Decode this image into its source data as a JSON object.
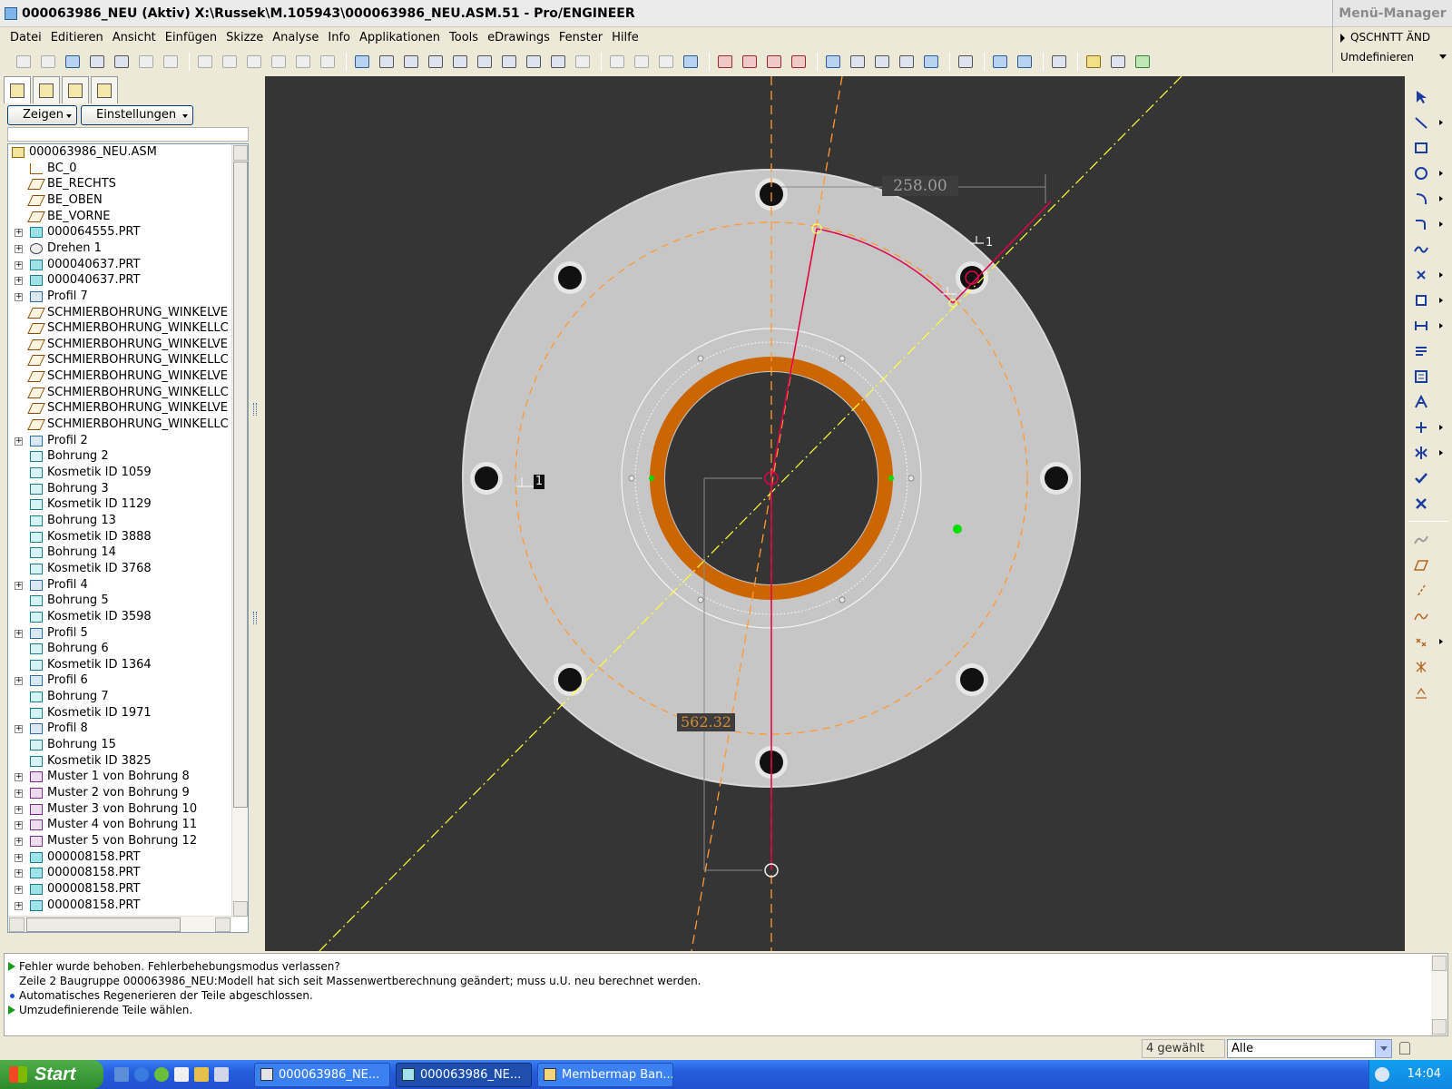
{
  "window": {
    "title": "000063986_NEU (Aktiv) X:\\Russek\\M.105943\\000063986_NEU.ASM.51 - Pro/ENGINEER"
  },
  "menu_manager": {
    "title": "Menü-Manager",
    "item_active": "QSCHNTT ÄND",
    "item_dropdown": "Umdefinieren"
  },
  "menubar": {
    "items": [
      "Datei",
      "Editieren",
      "Ansicht",
      "Einfügen",
      "Skizze",
      "Analyse",
      "Info",
      "Applikationen",
      "Tools",
      "eDrawings",
      "Fenster",
      "Hilfe"
    ]
  },
  "left_panel": {
    "show_button": "Zeigen",
    "settings_button": "Einstellungen",
    "root": "000063986_NEU.ASM",
    "tree": [
      {
        "label": "BC_0",
        "icon": "csys-icon",
        "exp": ""
      },
      {
        "label": "BE_RECHTS",
        "icon": "datum-plane-icon",
        "exp": ""
      },
      {
        "label": "BE_OBEN",
        "icon": "datum-plane-icon",
        "exp": ""
      },
      {
        "label": "BE_VORNE",
        "icon": "datum-plane-icon",
        "exp": ""
      },
      {
        "label": "000064555.PRT",
        "icon": "part-icon",
        "exp": "+"
      },
      {
        "label": "Drehen 1",
        "icon": "revolve-icon",
        "exp": "+"
      },
      {
        "label": "000040637.PRT",
        "icon": "part-icon",
        "exp": "+"
      },
      {
        "label": "000040637.PRT",
        "icon": "part-icon",
        "exp": "+"
      },
      {
        "label": "Profil 7",
        "icon": "profile-icon",
        "exp": "+"
      },
      {
        "label": "SCHMIERBOHRUNG_WINKELVE",
        "icon": "datum-plane-icon",
        "exp": ""
      },
      {
        "label": "SCHMIERBOHRUNG_WINKELLC",
        "icon": "datum-plane-icon",
        "exp": ""
      },
      {
        "label": "SCHMIERBOHRUNG_WINKELVE",
        "icon": "datum-plane-icon",
        "exp": ""
      },
      {
        "label": "SCHMIERBOHRUNG_WINKELLC",
        "icon": "datum-plane-icon",
        "exp": ""
      },
      {
        "label": "SCHMIERBOHRUNG_WINKELVE",
        "icon": "datum-plane-icon",
        "exp": ""
      },
      {
        "label": "SCHMIERBOHRUNG_WINKELLC",
        "icon": "datum-plane-icon",
        "exp": ""
      },
      {
        "label": "SCHMIERBOHRUNG_WINKELVE",
        "icon": "datum-plane-icon",
        "exp": ""
      },
      {
        "label": "SCHMIERBOHRUNG_WINKELLC",
        "icon": "datum-plane-icon",
        "exp": ""
      },
      {
        "label": "Profil 2",
        "icon": "profile-icon",
        "exp": "+"
      },
      {
        "label": "Bohrung 2",
        "icon": "hole-icon",
        "exp": ""
      },
      {
        "label": "Kosmetik ID 1059",
        "icon": "cosmetic-icon",
        "exp": ""
      },
      {
        "label": "Bohrung 3",
        "icon": "hole-icon",
        "exp": ""
      },
      {
        "label": "Kosmetik ID 1129",
        "icon": "cosmetic-icon",
        "exp": ""
      },
      {
        "label": "Bohrung 13",
        "icon": "hole-icon",
        "exp": ""
      },
      {
        "label": "Kosmetik ID 3888",
        "icon": "cosmetic-icon",
        "exp": ""
      },
      {
        "label": "Bohrung 14",
        "icon": "hole-icon",
        "exp": ""
      },
      {
        "label": "Kosmetik ID 3768",
        "icon": "cosmetic-icon",
        "exp": ""
      },
      {
        "label": "Profil 4",
        "icon": "profile-icon",
        "exp": "+"
      },
      {
        "label": "Bohrung 5",
        "icon": "hole-icon",
        "exp": ""
      },
      {
        "label": "Kosmetik ID 3598",
        "icon": "cosmetic-icon",
        "exp": ""
      },
      {
        "label": "Profil 5",
        "icon": "profile-icon",
        "exp": "+"
      },
      {
        "label": "Bohrung 6",
        "icon": "hole-icon",
        "exp": ""
      },
      {
        "label": "Kosmetik ID 1364",
        "icon": "cosmetic-icon",
        "exp": ""
      },
      {
        "label": "Profil 6",
        "icon": "profile-icon",
        "exp": "+"
      },
      {
        "label": "Bohrung 7",
        "icon": "hole-icon",
        "exp": ""
      },
      {
        "label": "Kosmetik ID 1971",
        "icon": "cosmetic-icon",
        "exp": ""
      },
      {
        "label": "Profil 8",
        "icon": "profile-icon",
        "exp": "+"
      },
      {
        "label": "Bohrung 15",
        "icon": "hole-icon",
        "exp": ""
      },
      {
        "label": "Kosmetik ID 3825",
        "icon": "cosmetic-icon",
        "exp": ""
      },
      {
        "label": "Muster 1 von Bohrung 8",
        "icon": "pattern-icon",
        "exp": "+"
      },
      {
        "label": "Muster 2 von Bohrung 9",
        "icon": "pattern-icon",
        "exp": "+"
      },
      {
        "label": "Muster 3 von Bohrung 10",
        "icon": "pattern-icon",
        "exp": "+"
      },
      {
        "label": "Muster 4 von Bohrung 11",
        "icon": "pattern-icon",
        "exp": "+"
      },
      {
        "label": "Muster 5 von Bohrung 12",
        "icon": "pattern-icon",
        "exp": "+"
      },
      {
        "label": "000008158.PRT",
        "icon": "part-icon",
        "exp": "+"
      },
      {
        "label": "000008158.PRT",
        "icon": "part-icon",
        "exp": "+"
      },
      {
        "label": "000008158.PRT",
        "icon": "part-icon",
        "exp": "+"
      },
      {
        "label": "000008158.PRT",
        "icon": "part-icon",
        "exp": "+"
      }
    ]
  },
  "graphics": {
    "dimension_horizontal": "258.00",
    "dimension_vertical": "562.32",
    "constraint_label": "1",
    "colors": {
      "background": "#353535",
      "part": "#c6c6c6",
      "ring": "#cc6600",
      "sketch": "#e0004a",
      "centerline": "#ffff33",
      "construction": "#ff9933"
    }
  },
  "messages": [
    {
      "type": "prompt",
      "text": "Fehler wurde behoben. Fehlerbehebungsmodus verlassen?"
    },
    {
      "type": "info",
      "text": "Zeile 2 Baugruppe 000063986_NEU:Modell hat sich seit Massenwertberechnung geändert; muss u.U. neu berechnet werden."
    },
    {
      "type": "bullet",
      "text": "Automatisches Regenerieren der Teile abgeschlossen."
    },
    {
      "type": "prompt",
      "text": "Umzudefinierende Teile wählen."
    }
  ],
  "status": {
    "selected": "4 gewählt",
    "filter": "Alle"
  },
  "taskbar": {
    "start": "Start",
    "tasks": [
      "000063986_NE...",
      "000063986_NE...",
      "Membermap Ban..."
    ],
    "clock": "14:04"
  }
}
